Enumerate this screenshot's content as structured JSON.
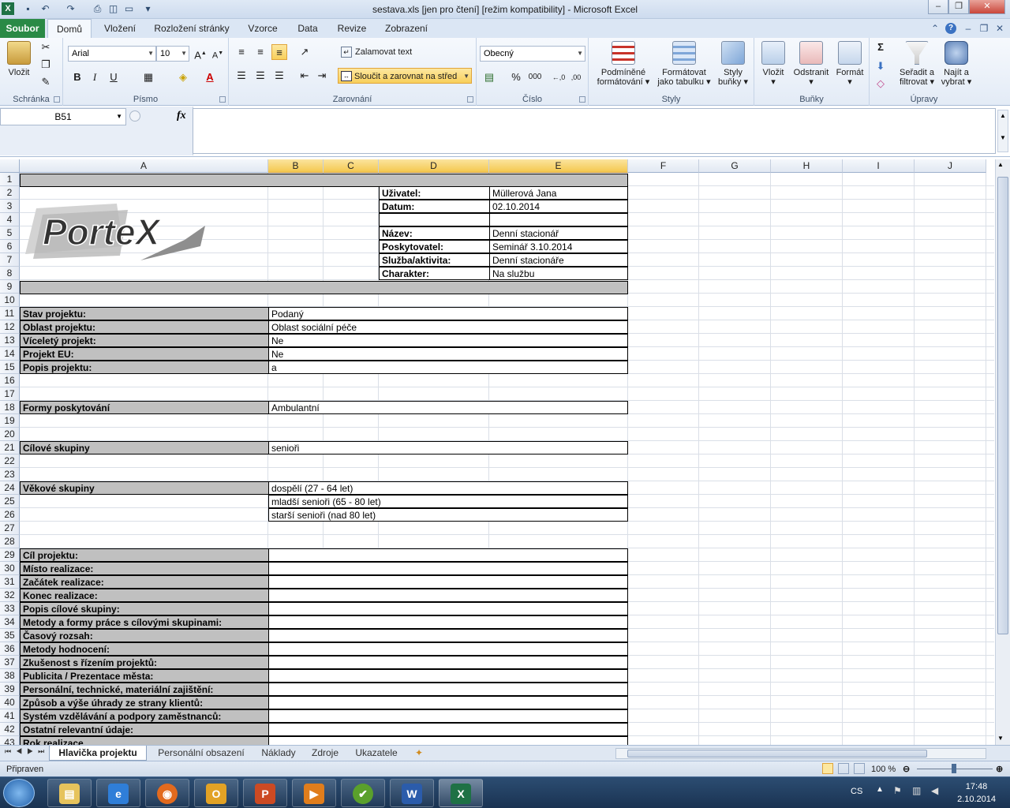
{
  "window": {
    "title": "sestava.xls  [jen pro čtení]  [režim kompatibility]  -  Microsoft Excel",
    "minimize": "–",
    "restore": "❐",
    "close": "✕"
  },
  "tabs": {
    "file": "Soubor",
    "items": [
      "Domů",
      "Vložení",
      "Rozložení stránky",
      "Vzorce",
      "Data",
      "Revize",
      "Zobrazení"
    ]
  },
  "ribbon": {
    "clipboard": {
      "label": "Schránka",
      "paste": "Vložit"
    },
    "font": {
      "label": "Písmo",
      "name": "Arial",
      "size": "10"
    },
    "alignment": {
      "label": "Zarovnání",
      "wrap": "Zalamovat text",
      "merge": "Sloučit a zarovnat na střed"
    },
    "number": {
      "label": "Číslo",
      "format": "Obecný"
    },
    "styles": {
      "label": "Styly",
      "cond1": "Podmíněné",
      "cond2": "formátování",
      "table1": "Formátovat",
      "table2": "jako tabulku",
      "cell1": "Styly",
      "cell2": "buňky"
    },
    "cells": {
      "label": "Buňky",
      "insert": "Vložit",
      "delete": "Odstranit",
      "format": "Formát"
    },
    "editing": {
      "label": "Úpravy",
      "sort1": "Seřadit a",
      "sort2": "filtrovat",
      "find1": "Najít a",
      "find2": "vybrat"
    }
  },
  "formula_bar": {
    "name_box": "B51",
    "fx": "fx",
    "content": ""
  },
  "columns": [
    "A",
    "B",
    "C",
    "D",
    "E",
    "F",
    "G",
    "H",
    "I",
    "J"
  ],
  "rows": [
    "1",
    "2",
    "3",
    "4",
    "5",
    "6",
    "7",
    "8",
    "9",
    "10",
    "11",
    "12",
    "13",
    "14",
    "15",
    "16",
    "17",
    "18",
    "19",
    "20",
    "21",
    "22",
    "23",
    "24",
    "25",
    "26",
    "27",
    "28",
    "29",
    "30",
    "31",
    "32",
    "33",
    "34",
    "35",
    "36",
    "37",
    "38",
    "39",
    "40",
    "41",
    "42",
    "43"
  ],
  "logo_text": "PorteX",
  "header_info": [
    {
      "label": "Uživatel:",
      "value": "Müllerová Jana"
    },
    {
      "label": "Datum:",
      "value": "02.10.2014"
    },
    {
      "label": "",
      "value": ""
    },
    {
      "label": "Název:",
      "value": "Denní stacionář"
    },
    {
      "label": "Poskytovatel:",
      "value": "Seminář 3.10.2014"
    },
    {
      "label": "Služba/aktivita:",
      "value": "Denní stacionáře"
    },
    {
      "label": "Charakter:",
      "value": "Na službu"
    }
  ],
  "project": [
    {
      "label": "Stav projektu:",
      "value": "Podaný"
    },
    {
      "label": "Oblast projektu:",
      "value": "Oblast sociální péče"
    },
    {
      "label": "Víceletý projekt:",
      "value": "Ne"
    },
    {
      "label": "Projekt EU:",
      "value": "Ne"
    },
    {
      "label": "Popis projektu:",
      "value": "a"
    }
  ],
  "forms": {
    "label": "Formy poskytování",
    "value": "Ambulantní"
  },
  "targets": {
    "label": "Cílové skupiny",
    "value": "senioři"
  },
  "ages": {
    "label": "Věkové skupiny",
    "values": [
      "dospělí (27 - 64 let)",
      "mladší senioři (65 - 80 let)",
      "starší senioři (nad 80 let)"
    ]
  },
  "details": [
    "Cíl projektu:",
    "Místo realizace:",
    "Začátek realizace:",
    "Konec realizace:",
    "Popis cílové skupiny:",
    "Metody a formy práce s cílovými skupinami:",
    "Časový rozsah:",
    "Metody hodnocení:",
    "Zkušenost s řízením projektů:",
    "Publicita / Prezentace města:",
    "Personální, technické, materiální zajištění:",
    "Způsob a výše úhrady ze strany klientů:",
    "Systém vzdělávání a podpory zaměstnanců:",
    "Ostatní relevantní údaje:",
    "Rok realizace"
  ],
  "sheets": [
    "Hlavička projektu",
    "Personální obsazení",
    "Náklady",
    "Zdroje",
    "Ukazatele"
  ],
  "status": {
    "ready": "Připraven",
    "zoom": "100 %"
  },
  "taskbar": {
    "lang": "CS",
    "time": "17:48",
    "date": "2.10.2014"
  }
}
